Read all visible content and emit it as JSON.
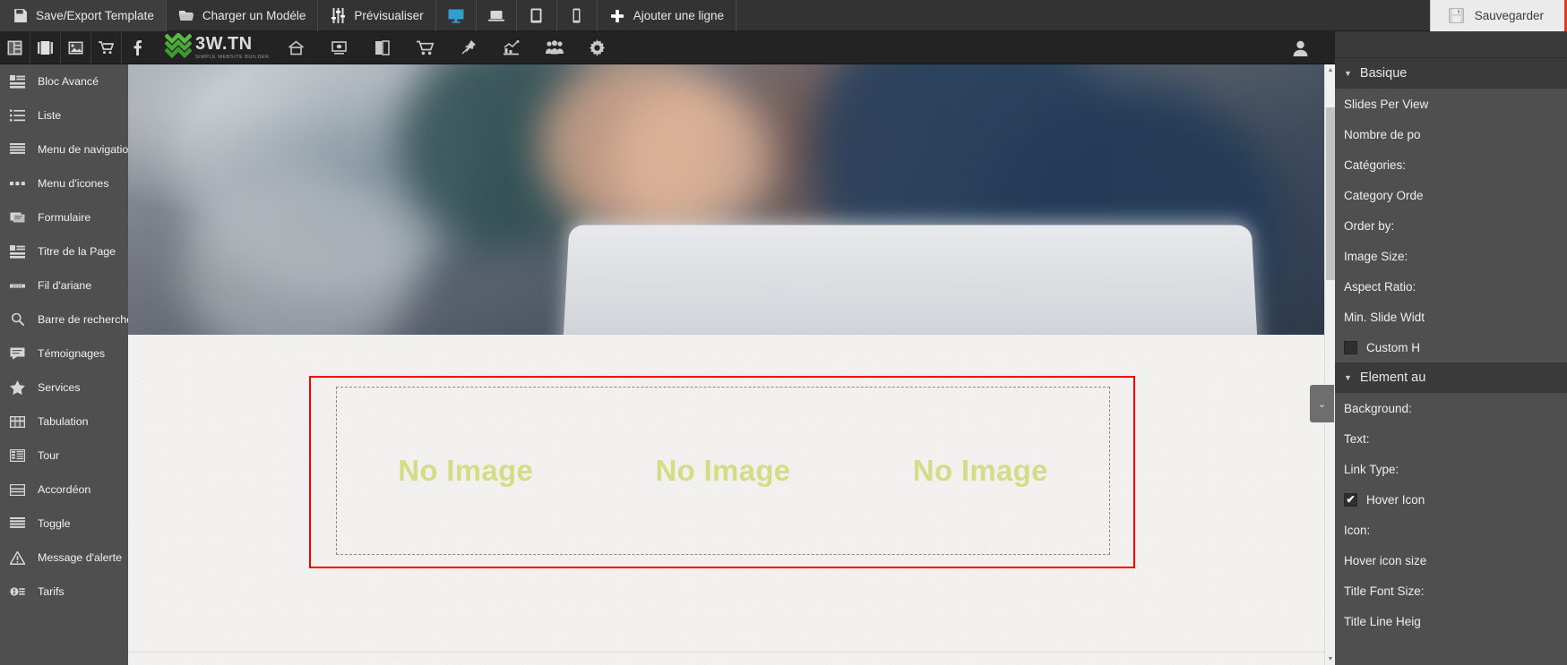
{
  "toolbar": {
    "items": [
      {
        "label": "Save/Export Template",
        "icon": "save-template-icon"
      },
      {
        "label": "Charger un Modéle",
        "icon": "folder-open-icon"
      },
      {
        "label": "Prévisualiser",
        "icon": "sliders-icon"
      }
    ],
    "device_buttons": [
      {
        "name": "desktop",
        "icon": "monitor-icon",
        "active": true
      },
      {
        "name": "laptop",
        "icon": "laptop-icon",
        "active": false
      },
      {
        "name": "tablet",
        "icon": "tablet-icon",
        "active": false
      },
      {
        "name": "mobile",
        "icon": "mobile-icon",
        "active": false
      }
    ],
    "add_row_label": "Ajouter une ligne",
    "save_label": "Sauvegarder",
    "accent_color": "#e03a26",
    "active_device_color": "#2f9fd0"
  },
  "site_nav": {
    "left_icons": [
      "layout-icon",
      "slideshow-icon",
      "image-icon",
      "cart-icon",
      "facebook-icon"
    ],
    "logo": {
      "text": "3W",
      "dot": ".",
      "tld": "TN",
      "tagline": "SIMPLE WEBSITE BUILDER",
      "color": "#5aba47"
    },
    "menu_icons": [
      "home-icon",
      "projector-icon",
      "book-icon",
      "shopping-cart-icon",
      "pin-icon",
      "chart-icon",
      "users-icon",
      "gear-icon"
    ],
    "user_icon": "user-icon"
  },
  "left_sidebar": {
    "items": [
      {
        "label": "Bloc Avancé",
        "icon": "advanced-block-icon"
      },
      {
        "label": "Liste",
        "icon": "list-icon"
      },
      {
        "label": "Menu de navigation",
        "icon": "nav-menu-icon"
      },
      {
        "label": "Menu d'icones",
        "icon": "icon-menu-icon"
      },
      {
        "label": "Formulaire",
        "icon": "form-icon"
      },
      {
        "label": "Titre de la Page",
        "icon": "page-title-icon"
      },
      {
        "label": "Fil d'ariane",
        "icon": "breadcrumb-icon"
      },
      {
        "label": "Barre de recherche",
        "icon": "search-icon"
      },
      {
        "label": "Témoignages",
        "icon": "testimonial-icon"
      },
      {
        "label": "Services",
        "icon": "star-icon"
      },
      {
        "label": "Tabulation",
        "icon": "tabs-icon"
      },
      {
        "label": "Tour",
        "icon": "tour-icon"
      },
      {
        "label": "Accordéon",
        "icon": "accordion-icon"
      },
      {
        "label": "Toggle",
        "icon": "toggle-icon"
      },
      {
        "label": "Message d'alerte",
        "icon": "alert-icon"
      },
      {
        "label": "Tarifs",
        "icon": "pricing-icon"
      }
    ],
    "collapse_arrow": "‹"
  },
  "canvas": {
    "placeholders": [
      "No Image",
      "No Image",
      "No Image"
    ],
    "placeholder_color": "#d2dd86",
    "selection_border_color": "#ff0000"
  },
  "right_panel": {
    "sections": [
      {
        "title": "Basique",
        "caret": "▼",
        "fields": [
          {
            "label": "Slides Per View",
            "type": "text"
          },
          {
            "label": "Nombre de po",
            "type": "text"
          },
          {
            "label": "Catégories:",
            "type": "text"
          },
          {
            "label": "Category Orde",
            "type": "text"
          },
          {
            "label": "Order by:",
            "type": "text"
          },
          {
            "label": "Image Size:",
            "type": "text"
          },
          {
            "label": "Aspect Ratio:",
            "type": "text"
          },
          {
            "label": "Min. Slide Widt",
            "type": "text"
          },
          {
            "label": "Custom H",
            "type": "checkbox",
            "checked": false
          }
        ]
      },
      {
        "title": "Element au",
        "caret": "▼",
        "fields": [
          {
            "label": "Background:",
            "type": "text"
          },
          {
            "label": "Text:",
            "type": "text"
          },
          {
            "label": "Link Type:",
            "type": "text"
          },
          {
            "label": "Hover Icon",
            "type": "checkbox",
            "checked": true
          },
          {
            "label": "Icon:",
            "type": "text"
          },
          {
            "label": "Hover icon size",
            "type": "text"
          },
          {
            "label": "Title Font Size:",
            "type": "text"
          },
          {
            "label": "Title Line Heig",
            "type": "text"
          }
        ]
      }
    ],
    "toggle_caret": "⌄"
  }
}
